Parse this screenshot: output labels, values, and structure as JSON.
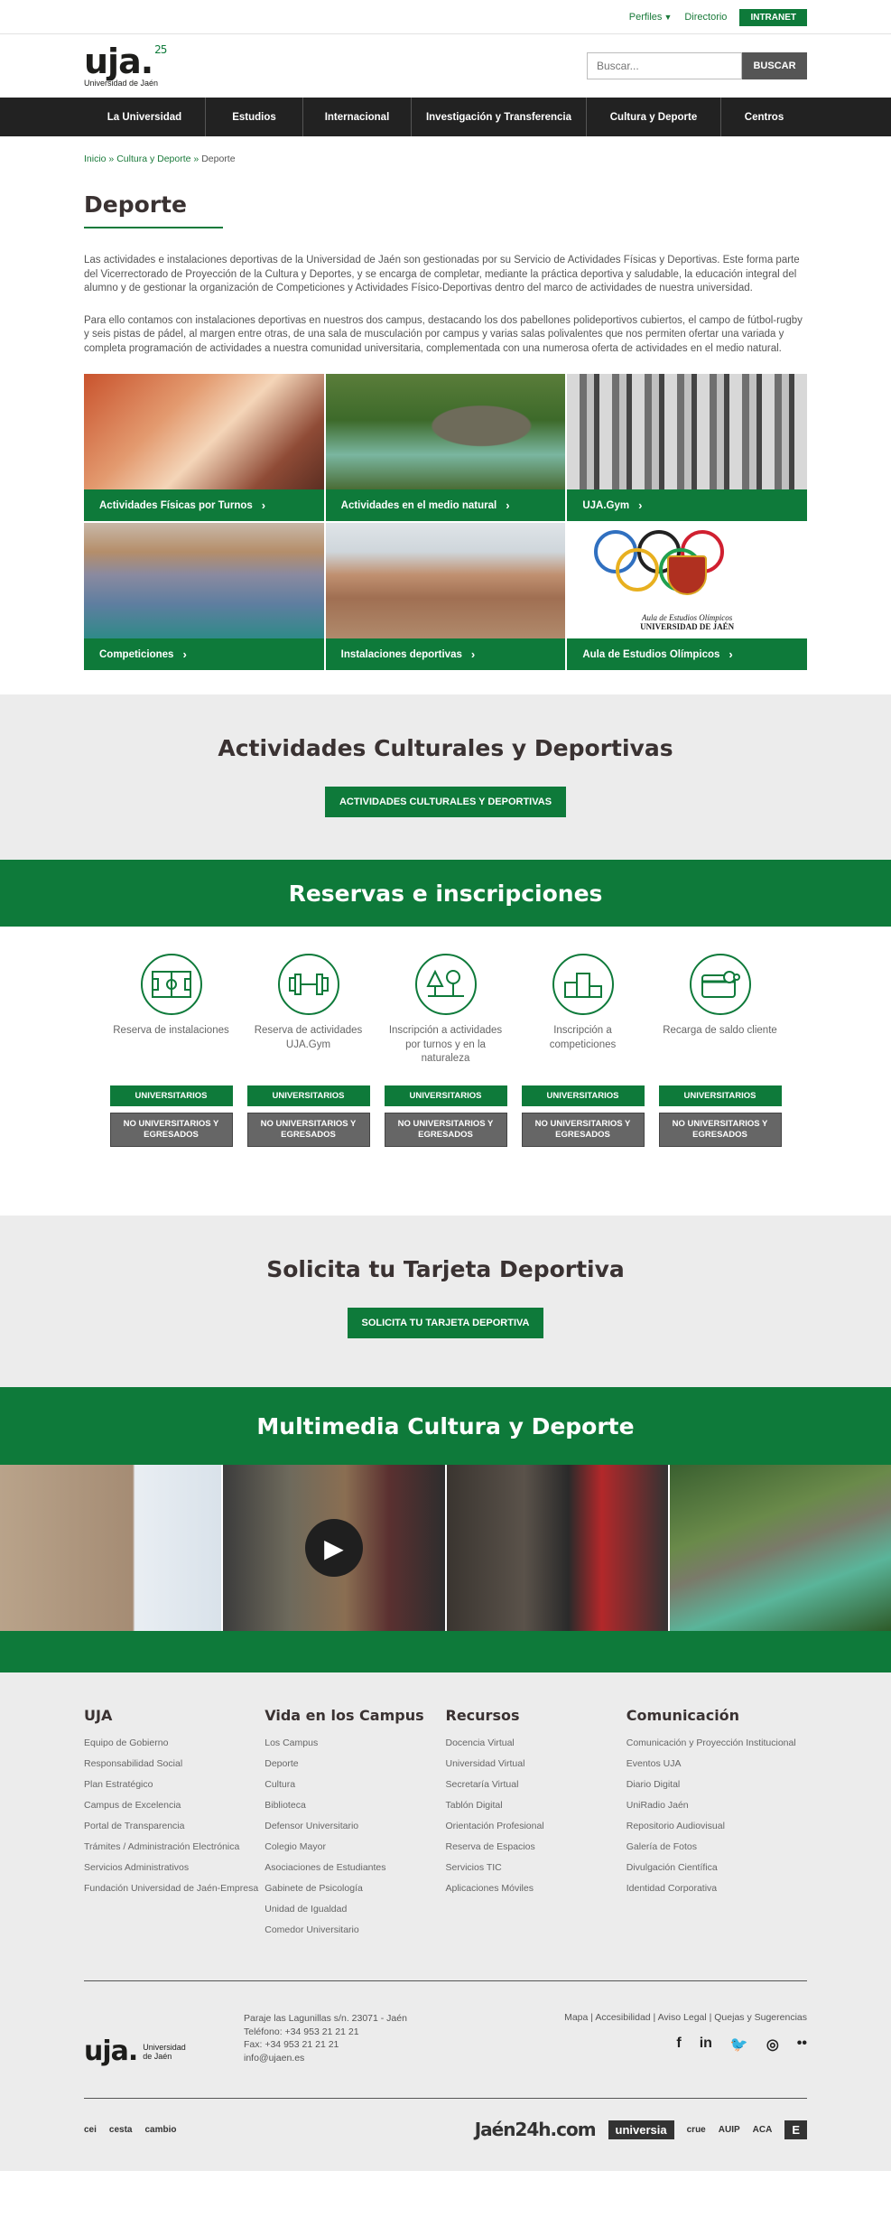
{
  "topbar": {
    "perfiles": "Perfiles",
    "directorio": "Directorio",
    "intranet": "INTRANET"
  },
  "header": {
    "logo_text": "uja.",
    "logo_badge": "25",
    "logo_sub": "Universidad de Jaén",
    "search_placeholder": "Buscar...",
    "search_button": "BUSCAR"
  },
  "nav": {
    "items": [
      {
        "label": "La Universidad"
      },
      {
        "label": "Estudios"
      },
      {
        "label": "Internacional"
      },
      {
        "label": "Investigación y Transferencia"
      },
      {
        "label": "Cultura y Deporte"
      },
      {
        "label": "Centros"
      }
    ]
  },
  "breadcrumb": {
    "home": "Inicio",
    "sep": " » ",
    "section": "Cultura y Deporte",
    "current": "Deporte"
  },
  "page": {
    "title": "Deporte",
    "intro_1": "Las actividades e instalaciones deportivas de la Universidad de Jaén son gestionadas por su Servicio de Actividades Físicas y Deportivas. Este forma parte del Vicerrectorado de Proyección de la Cultura y Deportes, y se encarga de completar, mediante la práctica deportiva y saludable, la educación integral del alumno y de gestionar la organización de Competiciones y Actividades Físico-Deportivas dentro del marco de actividades de nuestra universidad.",
    "intro_2": "Para ello contamos con instalaciones deportivas en nuestros dos campus, destacando los dos pabellones polideportivos cubiertos, el campo de fútbol-rugby y seis pistas de pádel, al margen entre otras, de una sala de musculación por campus y varias salas polivalentes que nos permiten ofertar una variada y completa programación de actividades a nuestra comunidad universitaria, complementada con una numerosa oferta de actividades en el medio natural."
  },
  "cards": [
    {
      "label": "Actividades Físicas por Turnos"
    },
    {
      "label": "Actividades en el medio natural"
    },
    {
      "label": "UJA.Gym"
    },
    {
      "label": "Competiciones"
    },
    {
      "label": "Instalaciones deportivas"
    },
    {
      "label": "Aula de Estudios Olímpicos"
    }
  ],
  "olympic": {
    "line1": "Aula de Estudios Olímpicos",
    "line2": "UNIVERSIDAD DE JAÉN"
  },
  "culturales": {
    "title": "Actividades Culturales y Deportivas",
    "button": "ACTIVIDADES CULTURALES Y DEPORTIVAS"
  },
  "reservas": {
    "title": "Reservas e inscripciones",
    "btn_univ": "UNIVERSITARIOS",
    "btn_nouniv": "NO UNIVERSITARIOS Y EGRESADOS",
    "items": [
      {
        "label": "Reserva de instalaciones",
        "icon": "field-icon"
      },
      {
        "label": "Reserva de actividades UJA.Gym",
        "icon": "dumbbell-icon"
      },
      {
        "label": "Inscripción a actividades por turnos y en la naturaleza",
        "icon": "nature-icon"
      },
      {
        "label": "Inscripción a competiciones",
        "icon": "podium-icon"
      },
      {
        "label": "Recarga de saldo cliente",
        "icon": "card-icon"
      }
    ]
  },
  "tarjeta": {
    "title": "Solicita tu Tarjeta Deportiva",
    "button": "SOLICITA TU TARJETA DEPORTIVA"
  },
  "multimedia": {
    "title": "Multimedia Cultura y Deporte"
  },
  "footer": {
    "columns": [
      {
        "title": "UJA",
        "links": [
          "Equipo de Gobierno",
          "Responsabilidad Social",
          "Plan Estratégico",
          "Campus de Excelencia",
          "Portal de Transparencia",
          "Trámites / Administración Electrónica",
          "Servicios Administrativos",
          "Fundación Universidad de Jaén-Empresa"
        ]
      },
      {
        "title": "Vida en los Campus",
        "links": [
          "Los Campus",
          "Deporte",
          "Cultura",
          "Biblioteca",
          "Defensor Universitario",
          "Colegio Mayor",
          "Asociaciones de Estudiantes",
          "Gabinete de Psicología",
          "Unidad de Igualdad",
          "Comedor Universitario"
        ]
      },
      {
        "title": "Recursos",
        "links": [
          "Docencia Virtual",
          "Universidad Virtual",
          "Secretaría Virtual",
          "Tablón Digital",
          "Orientación Profesional",
          "Reserva de Espacios",
          "Servicios TIC",
          "Aplicaciones Móviles"
        ]
      },
      {
        "title": "Comunicación",
        "links": [
          "Comunicación y Proyección Institucional",
          "Eventos UJA",
          "Diario Digital",
          "UniRadio Jaén",
          "Repositorio Audiovisual",
          "Galería de Fotos",
          "Divulgación Científica",
          "Identidad Corporativa"
        ]
      }
    ],
    "logo_text": "uja.",
    "logo_sub": "Universidad de Jaén",
    "address": "Paraje las Lagunillas s/n. 23071 - Jaén",
    "phone": "Teléfono: +34 953 21 21 21",
    "fax": "Fax: +34 953 21 21 21",
    "email": "info@ujaen.es",
    "legal_links": "Mapa | Accesibilidad | Aviso Legal | Quejas y Sugerencias",
    "social": {
      "facebook": "f",
      "linkedin": "in",
      "twitter": "🐦",
      "instagram": "◎",
      "flickr": "••"
    },
    "partners_left": [
      "cei",
      "cesta",
      "cambio"
    ],
    "partners_right": [
      "Jaén24h.com",
      "universia",
      "crue",
      "AUIP",
      "ACA",
      "E"
    ]
  }
}
